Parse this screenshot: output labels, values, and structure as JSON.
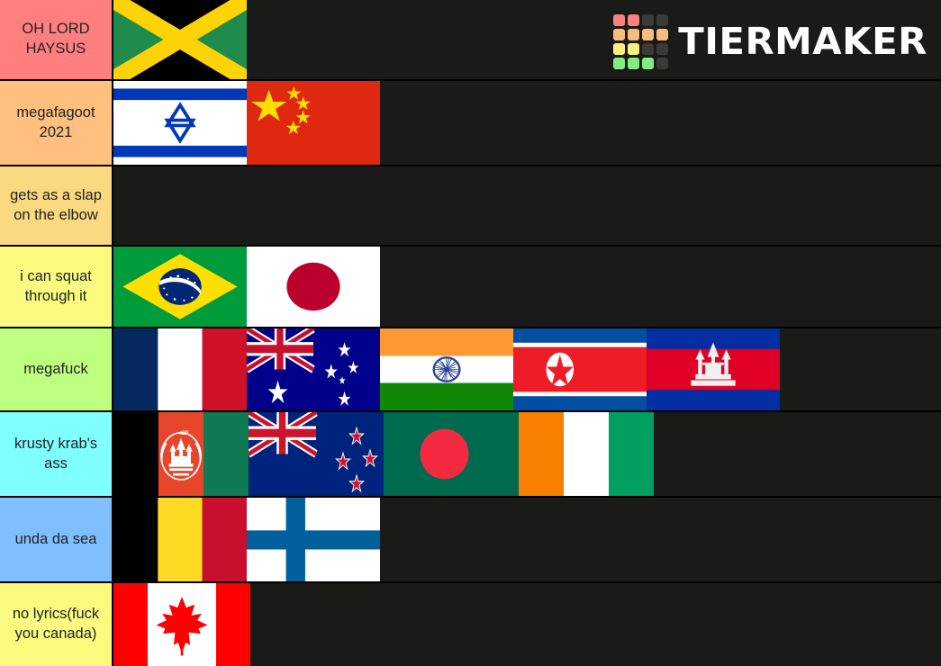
{
  "brand": {
    "name": "TIERMAKER",
    "logo_colors": {
      "red": "#f88181",
      "orange": "#f7bd80",
      "yellow": "#f9f07f",
      "green": "#83ec80",
      "empty": "#3a3a37"
    },
    "logo_grid": [
      [
        "red",
        "red",
        "empty",
        "empty"
      ],
      [
        "orange",
        "orange",
        "orange",
        "orange"
      ],
      [
        "yellow",
        "yellow",
        "empty",
        "empty"
      ],
      [
        "green",
        "green",
        "green",
        "empty"
      ]
    ]
  },
  "background_color": "#1a1a18",
  "border_color": "#000000",
  "tiers": [
    {
      "label": "OH LORD HAYSUS",
      "color": "#ff7f7f",
      "items": [
        {
          "name": "jamaica-flag",
          "country": "Jamaica"
        }
      ]
    },
    {
      "label": "megafagoot 2021",
      "color": "#ffbf7f",
      "items": [
        {
          "name": "israel-flag",
          "country": "Israel"
        },
        {
          "name": "china-flag",
          "country": "China"
        }
      ]
    },
    {
      "label": "gets as a slap on the elbow",
      "color": "#fad980",
      "items": []
    },
    {
      "label": "i can squat through it",
      "color": "#fbfb7f",
      "items": [
        {
          "name": "brazil-flag",
          "country": "Brazil"
        },
        {
          "name": "japan-flag",
          "country": "Japan"
        }
      ]
    },
    {
      "label": "megafuck",
      "color": "#bfff7f",
      "items": [
        {
          "name": "france-flag",
          "country": "France"
        },
        {
          "name": "australia-flag",
          "country": "Australia"
        },
        {
          "name": "india-flag",
          "country": "India"
        },
        {
          "name": "north-korea-flag",
          "country": "North Korea"
        },
        {
          "name": "cambodia-flag",
          "country": "Cambodia"
        }
      ]
    },
    {
      "label": "krusty krab's ass",
      "color": "#7fffff",
      "items": [
        {
          "name": "afghanistan-flag",
          "country": "Afghanistan"
        },
        {
          "name": "new-zealand-flag",
          "country": "New Zealand"
        },
        {
          "name": "bangladesh-flag",
          "country": "Bangladesh"
        },
        {
          "name": "ivory-coast-flag",
          "country": "Ivory Coast"
        }
      ]
    },
    {
      "label": "unda da sea",
      "color": "#7fbfff",
      "items": [
        {
          "name": "belgium-flag",
          "country": "Belgium"
        },
        {
          "name": "finland-flag",
          "country": "Finland"
        }
      ]
    },
    {
      "label": "no lyrics(fuck you canada)",
      "color": "#fbfb7f",
      "items": [
        {
          "name": "canada-flag",
          "country": "Canada"
        }
      ]
    }
  ]
}
